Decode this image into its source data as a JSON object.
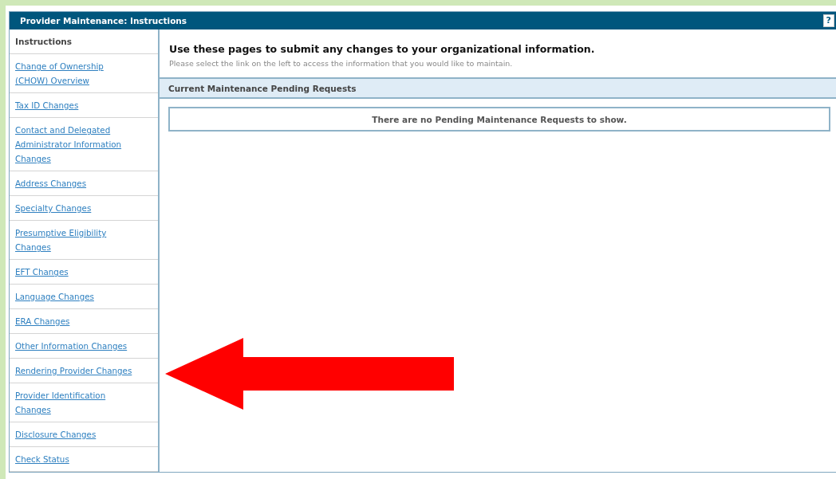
{
  "window": {
    "title": "Provider Maintenance: Instructions",
    "help_button": "?"
  },
  "sidebar": {
    "items": [
      {
        "label": "Instructions",
        "selected": true
      },
      {
        "label": "Change of Ownership (CHOW) Overview",
        "selected": false
      },
      {
        "label": "Tax ID Changes",
        "selected": false
      },
      {
        "label": "Contact and Delegated Administrator Information Changes",
        "selected": false
      },
      {
        "label": "Address Changes",
        "selected": false
      },
      {
        "label": "Specialty Changes",
        "selected": false
      },
      {
        "label": "Presumptive Eligibility Changes",
        "selected": false
      },
      {
        "label": "EFT Changes",
        "selected": false
      },
      {
        "label": "Language Changes",
        "selected": false
      },
      {
        "label": "ERA Changes",
        "selected": false
      },
      {
        "label": "Other Information Changes",
        "selected": false
      },
      {
        "label": "Rendering Provider Changes",
        "selected": false
      },
      {
        "label": "Provider Identification Changes",
        "selected": false
      },
      {
        "label": "Disclosure Changes",
        "selected": false
      },
      {
        "label": "Check Status",
        "selected": false
      }
    ]
  },
  "main": {
    "heading": "Use these pages to submit any changes to your organizational information.",
    "subtitle": "Please select the link on the left to access the information that you would like to maintain.",
    "section": {
      "title": "Current Maintenance Pending Requests",
      "message": "There are no Pending Maintenance Requests to show."
    }
  }
}
